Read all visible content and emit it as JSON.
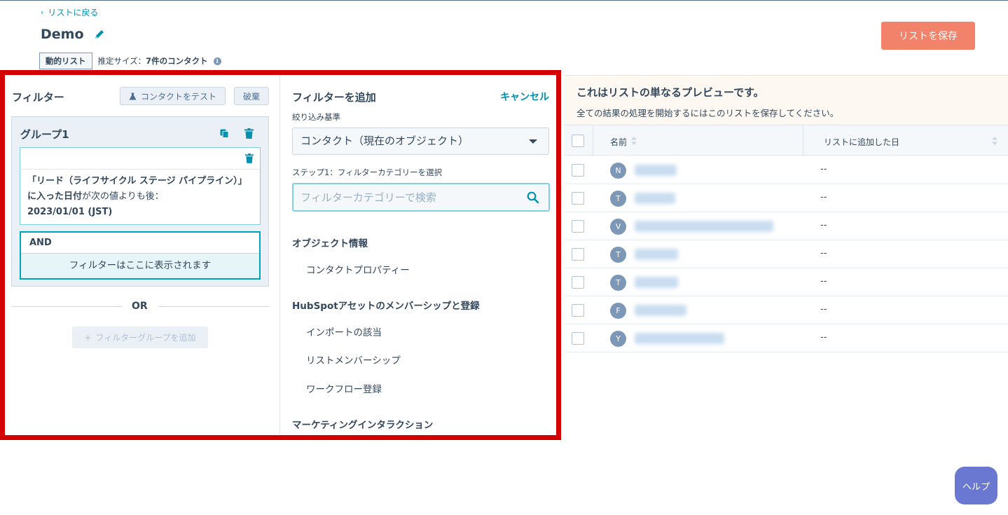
{
  "header": {
    "back_label": "リストに戻る",
    "title": "Demo",
    "list_type": "動的リスト",
    "size_label": "推定サイズ：",
    "size_value": "7件のコンタクト",
    "save_label": "リストを保存"
  },
  "filter_panel": {
    "title": "フィルター",
    "test_button": "コンタクトをテスト",
    "discard_button": "破棄",
    "group_title": "グループ1",
    "criteria_part1": "「リード（ライフサイクル ステージ パイプライン）」に入った日付",
    "criteria_part2": "が次の値よりも後：",
    "criteria_part3": "2023/01/01 (JST)",
    "and_label": "AND",
    "and_placeholder": "フィルターはここに表示されます",
    "or_label": "OR",
    "add_group_button": "フィルターグループを追加"
  },
  "add_filter": {
    "title": "フィルターを追加",
    "cancel": "キャンセル",
    "basis_label": "絞り込み基準",
    "object_select": "コンタクト（現在のオブジェクト）",
    "step_label": "ステップ1：フィルターカテゴリーを選択",
    "search_placeholder": "フィルターカテゴリーで検索",
    "sections": [
      {
        "heading": "オブジェクト情報",
        "items": [
          "コンタクトプロパティー"
        ]
      },
      {
        "heading": "HubSpotアセットのメンバーシップと登録",
        "items": [
          "インポートの該当",
          "リストメンバーシップ",
          "ワークフロー登録"
        ]
      },
      {
        "heading": "マーケティングインタラクション",
        "items": []
      }
    ]
  },
  "preview": {
    "title": "これはリストの単なるプレビューです。",
    "subtitle": "全ての結果の処理を開始するにはこのリストを保存してください。",
    "col_name": "名前",
    "col_date": "リストに追加した日",
    "rows": [
      {
        "initial": "N",
        "date": "--"
      },
      {
        "initial": "T",
        "date": "--"
      },
      {
        "initial": "V",
        "date": "--"
      },
      {
        "initial": "T",
        "date": "--"
      },
      {
        "initial": "T",
        "date": "--"
      },
      {
        "initial": "F",
        "date": "--"
      },
      {
        "initial": "Y",
        "date": "--"
      }
    ]
  },
  "help_label": "ヘルプ",
  "colors": {
    "accent": "#0091ae",
    "save": "#f2826a",
    "highlight_frame": "#d40000",
    "help": "#6a78d1"
  }
}
